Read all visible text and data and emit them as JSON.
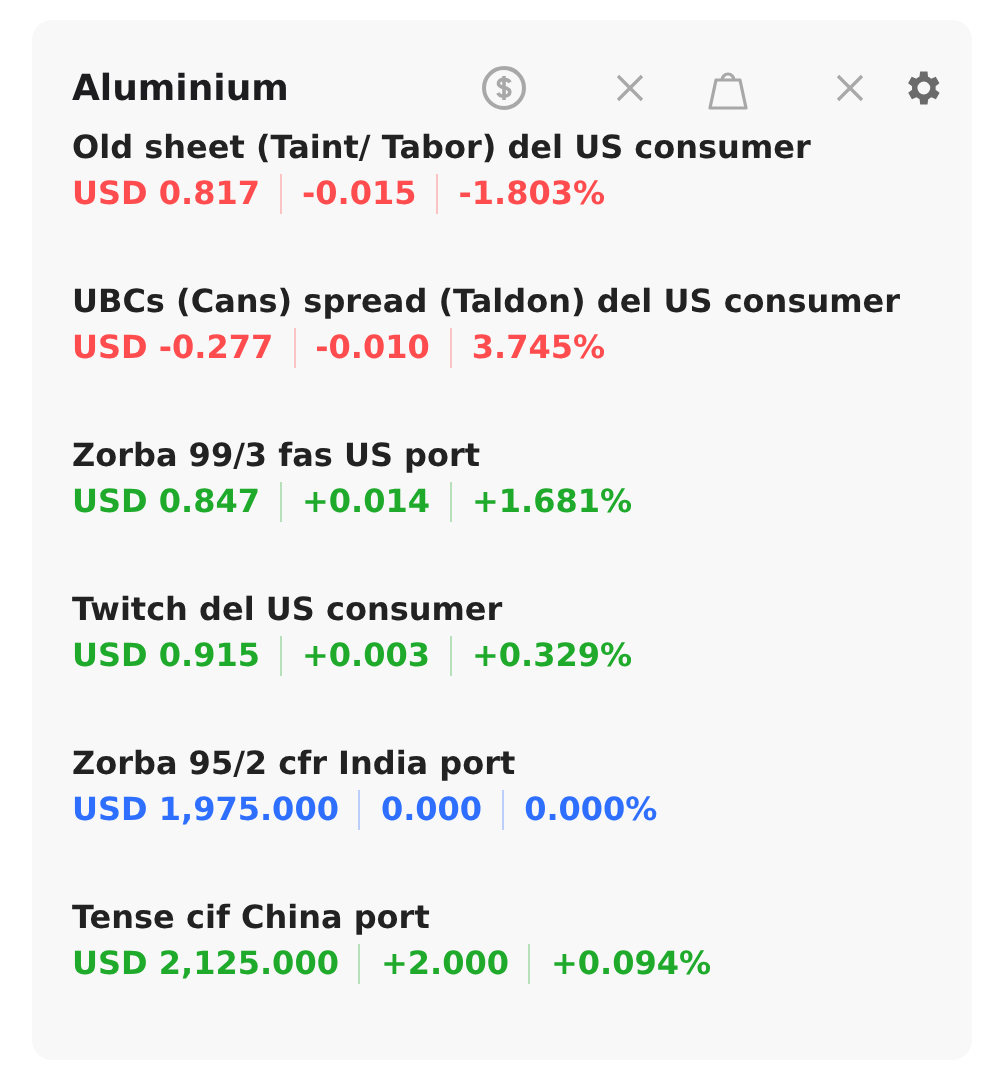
{
  "title": "Aluminium",
  "toolbar": [
    {
      "kind": "currency"
    },
    {
      "kind": "close"
    },
    {
      "kind": "weight"
    },
    {
      "kind": "close"
    },
    {
      "kind": "settings"
    }
  ],
  "items": [
    {
      "name": "Old sheet (Taint/ Tabor) del US consumer",
      "color": "#ff4d4f",
      "price": "USD 0.817",
      "change": "-0.015",
      "percent": "-1.803%"
    },
    {
      "name": "UBCs (Cans) spread (Taldon) del US consumer",
      "color": "#ff4d4f",
      "price": "USD -0.277",
      "change": "-0.010",
      "percent": "3.745%"
    },
    {
      "name": "Zorba 99/3 fas US port",
      "color": "#1faa2c",
      "price": "USD 0.847",
      "change": "+0.014",
      "percent": "+1.681%"
    },
    {
      "name": "Twitch del US consumer",
      "color": "#1faa2c",
      "price": "USD 0.915",
      "change": "+0.003",
      "percent": "+0.329%"
    },
    {
      "name": "Zorba 95/2 cfr India port",
      "color": "#2f6fff",
      "price": "USD 1,975.000",
      "change": "0.000",
      "percent": "0.000%"
    },
    {
      "name": "Tense cif China port",
      "color": "#1faa2c",
      "price": "USD 2,125.000",
      "change": "+2.000",
      "percent": "+0.094%"
    }
  ]
}
